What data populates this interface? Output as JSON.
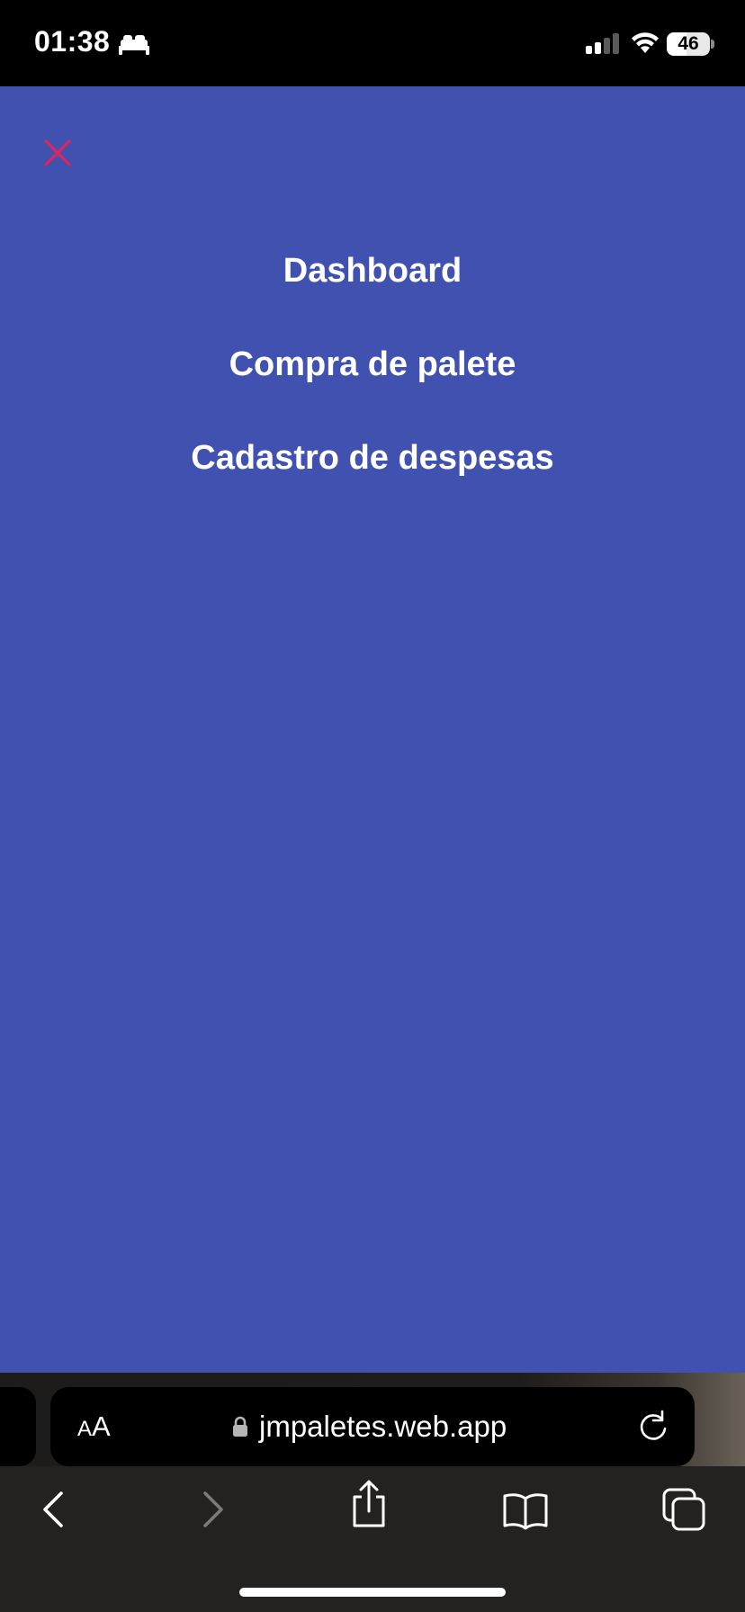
{
  "status_bar": {
    "time": "01:38",
    "focus_icon": "bed-icon",
    "battery_level": "46",
    "battery_fraction": 0.46
  },
  "menu": {
    "close_icon": "close-icon",
    "close_color": "#e0245e",
    "background_color": "#4151b0",
    "items": [
      {
        "label": "Dashboard"
      },
      {
        "label": "Compra de palete"
      },
      {
        "label": "Cadastro de despesas"
      }
    ]
  },
  "browser": {
    "aa_small": "A",
    "aa_big": "A",
    "url": "jmpaletes.web.app",
    "icons": [
      "lock-icon",
      "reload-icon",
      "back-icon",
      "forward-icon",
      "share-icon",
      "bookmarks-icon",
      "tabs-icon"
    ]
  }
}
